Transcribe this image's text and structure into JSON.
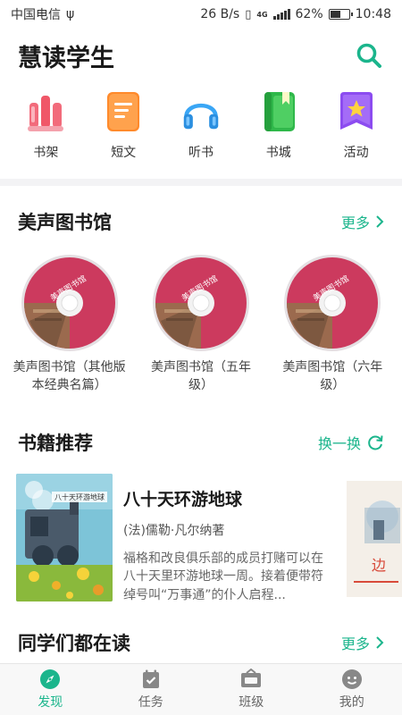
{
  "status_bar": {
    "carrier": "中国电信",
    "usb": "ψ",
    "speed": "26 B/s",
    "network": "4G",
    "battery": "62%",
    "time": "10:48"
  },
  "header": {
    "title": "慧读学生"
  },
  "quick_nav": [
    {
      "label": "书架",
      "icon": "bookshelf-icon"
    },
    {
      "label": "短文",
      "icon": "article-icon"
    },
    {
      "label": "听书",
      "icon": "headphones-icon"
    },
    {
      "label": "书城",
      "icon": "bookstore-icon"
    },
    {
      "label": "活动",
      "icon": "activity-icon"
    }
  ],
  "library": {
    "title": "美声图书馆",
    "more": "更多",
    "disc_text": "美声图书馆",
    "albums": [
      {
        "label": "美声图书馆（其他版本经典名篇）"
      },
      {
        "label": "美声图书馆（五年级）"
      },
      {
        "label": "美声图书馆（六年级）"
      }
    ]
  },
  "books": {
    "title": "书籍推荐",
    "refresh": "换一换",
    "featured": {
      "title": "八十天环游地球",
      "author": "(法)儒勒·凡尔纳著",
      "description": "福格和改良俱乐部的成员打赌可以在八十天里环游地球一周。接着便带符绰号叫“万事通”的仆人启程...",
      "cover_text": "八十天环游地球"
    },
    "next_cover_text": "边"
  },
  "classmates": {
    "title": "同学们都在读",
    "more": "更多"
  },
  "tabs": [
    {
      "label": "发现",
      "active": true
    },
    {
      "label": "任务",
      "active": false
    },
    {
      "label": "班级",
      "active": false
    },
    {
      "label": "我的",
      "active": false
    }
  ],
  "colors": {
    "accent": "#1bb58c",
    "disc": "#cc3a5e"
  }
}
